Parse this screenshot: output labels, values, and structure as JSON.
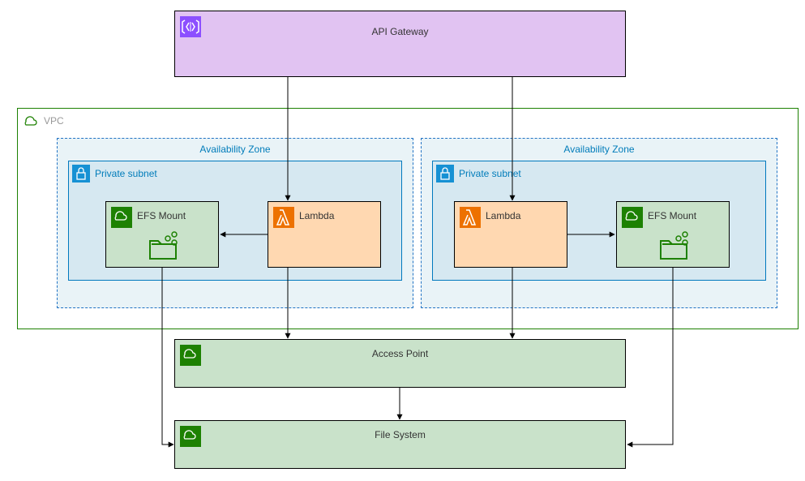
{
  "api_gateway": {
    "label": "API Gateway"
  },
  "vpc": {
    "label": "VPC"
  },
  "az": [
    {
      "label": "Availability Zone",
      "subnet_label": "Private subnet",
      "lambda_label": "Lambda",
      "efs_label": "EFS Mount"
    },
    {
      "label": "Availability Zone",
      "subnet_label": "Private subnet",
      "lambda_label": "Lambda",
      "efs_label": "EFS Mount"
    }
  ],
  "access_point": {
    "label": "Access Point"
  },
  "file_system": {
    "label": "File System"
  }
}
